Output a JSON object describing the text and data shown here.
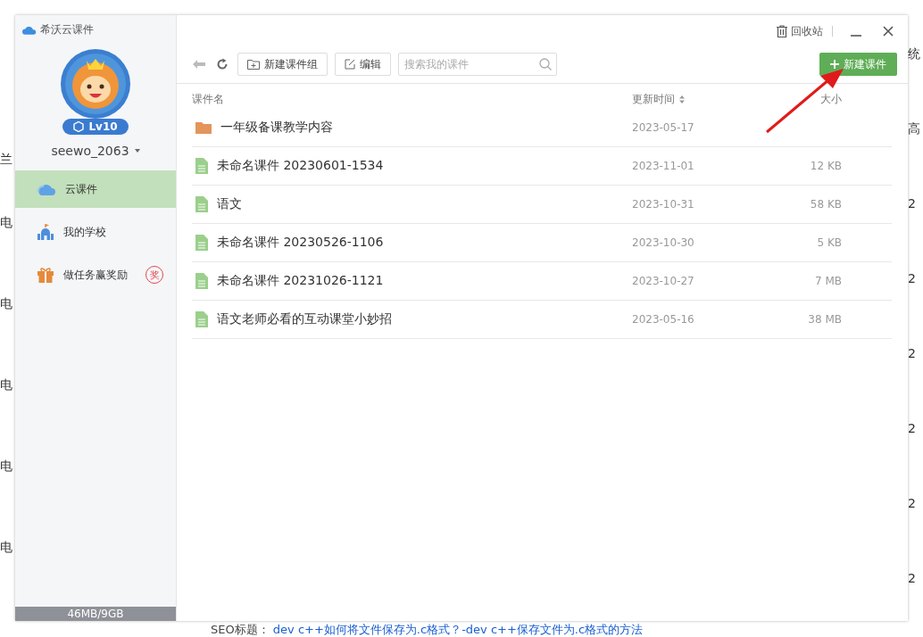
{
  "backdrop": {
    "left_fragments": [
      "兰",
      "电",
      "电",
      "电",
      "电",
      "电"
    ],
    "right_fragments": [
      "统",
      "高",
      "2",
      "2",
      "2",
      "2",
      "2",
      "2"
    ],
    "seo_label": "SEO标题：",
    "seo_link": "dev c++如何将文件保存为.c格式？-dev c++保存文件为.c格式的方法"
  },
  "window": {
    "title": "希沃云课件",
    "recycle_label": "回收站"
  },
  "profile": {
    "level": "Lv10",
    "username": "seewo_2063"
  },
  "sidebar": {
    "items": [
      {
        "label": "云课件",
        "kind": "cloud",
        "selected": true
      },
      {
        "label": "我的学校",
        "kind": "school",
        "selected": false
      },
      {
        "label": "做任务赢奖励",
        "kind": "gift",
        "selected": false,
        "badge": "奖"
      }
    ],
    "storage": "46MB/9GB"
  },
  "toolbar": {
    "new_group": "新建课件组",
    "edit": "编辑",
    "search": {
      "placeholder": "搜索我的课件"
    },
    "new_courseware": "新建课件"
  },
  "table": {
    "columns": [
      "课件名",
      "更新时间",
      "大小"
    ],
    "rows": [
      {
        "kind": "folder",
        "name": "一年级备课教学内容",
        "updated": "2023-05-17"
      },
      {
        "kind": "file",
        "name": "未命名课件 20230601-1534",
        "updated": "2023-11-01",
        "size": "12 KB"
      },
      {
        "kind": "file",
        "name": "语文",
        "updated": "2023-10-31",
        "size": "58 KB"
      },
      {
        "kind": "file",
        "name": "未命名课件 20230526-1106",
        "updated": "2023-10-30",
        "size": "5 KB"
      },
      {
        "kind": "file",
        "name": "未命名课件 20231026-1121",
        "updated": "2023-10-27",
        "size": "7 MB"
      },
      {
        "kind": "file",
        "name": "语文老师必看的互动课堂小妙招",
        "updated": "2023-05-16",
        "size": "38 MB"
      }
    ]
  }
}
